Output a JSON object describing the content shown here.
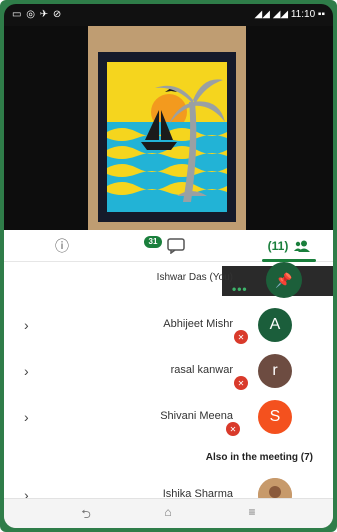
{
  "status_bar": {
    "left": "▭ ◎ ✈ ⊘",
    "right": "◢◢ ◢◢ 11:10 ▪▪"
  },
  "tabs": {
    "info_icon": "ⓘ",
    "chat_badge": "31",
    "people_label": "(11)"
  },
  "self": {
    "name": "Ishwar Das (You)"
  },
  "participants": [
    {
      "initial": "A",
      "name": "Abhijeet Mishr",
      "avatar_color": "#1b5e3b"
    },
    {
      "initial": "r",
      "name": "rasal kanwar",
      "avatar_color": "#6d4c41"
    },
    {
      "initial": "S",
      "name": "Shivani Meena",
      "avatar_color": "#f4511e"
    }
  ],
  "section_title": "Also in the meeting (7)",
  "also": [
    {
      "name": "Ishika Sharma"
    }
  ],
  "colors": {
    "accent": "#1a7f3c",
    "muted_mic": "#d93a2b"
  }
}
